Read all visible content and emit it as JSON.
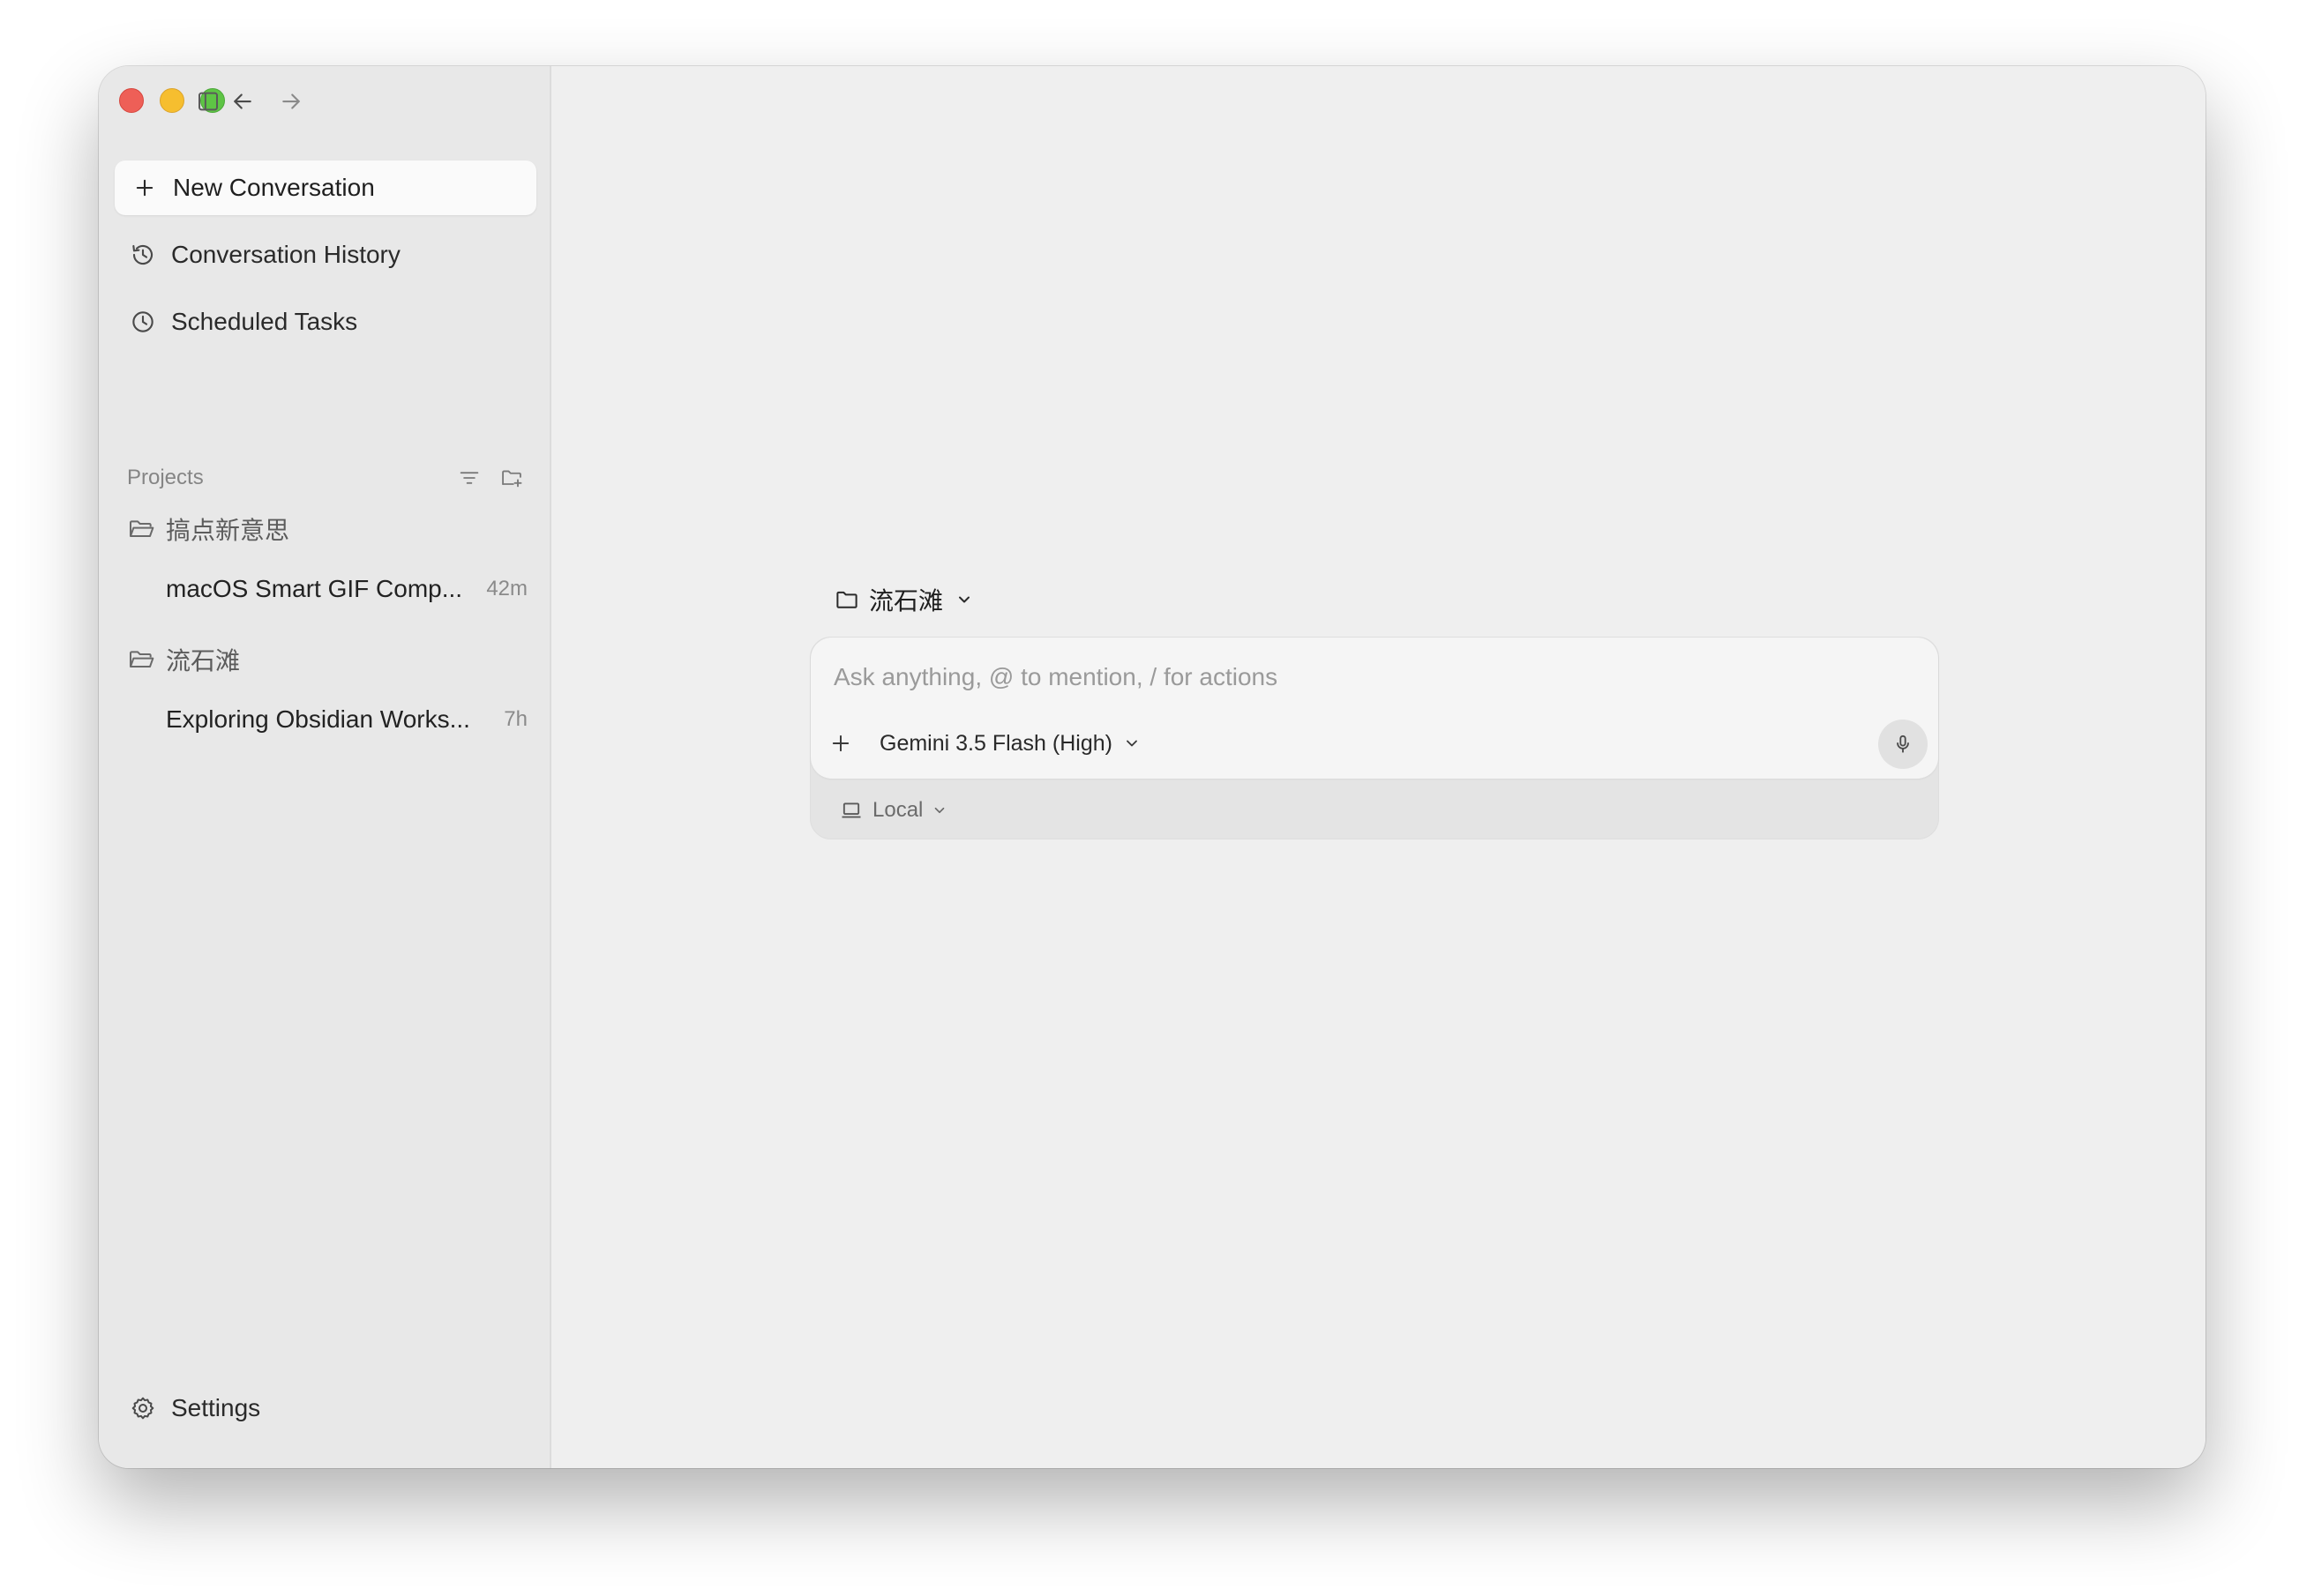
{
  "window": {
    "traffic_lights": [
      "close",
      "minimize",
      "zoom"
    ],
    "toolbar_icons": [
      "sidebar-toggle-icon",
      "back-arrow-icon",
      "forward-arrow-icon"
    ]
  },
  "sidebar": {
    "new_conversation": "New Conversation",
    "nav": [
      {
        "label": "Conversation History",
        "icon": "history-icon"
      },
      {
        "label": "Scheduled Tasks",
        "icon": "clock-icon"
      }
    ],
    "projects_label": "Projects",
    "projects": [
      {
        "name": "搞点新意思",
        "conversations": [
          {
            "title": "macOS Smart GIF Comp...",
            "time": "42m"
          }
        ]
      },
      {
        "name": "流石滩",
        "conversations": [
          {
            "title": "Exploring Obsidian Works...",
            "time": "7h"
          }
        ]
      }
    ],
    "settings_label": "Settings"
  },
  "main": {
    "workspace": "流石滩",
    "composer": {
      "placeholder": "Ask anything, @ to mention, / for actions",
      "value": "",
      "model": "Gemini 3.5 Flash (High)",
      "environment": "Local"
    }
  },
  "colors": {
    "close": "#ee5f57",
    "minimize": "#f6be2f",
    "zoom": "#5ec445",
    "sidebar_bg": "#e8e8e8",
    "main_bg": "#efefef"
  }
}
